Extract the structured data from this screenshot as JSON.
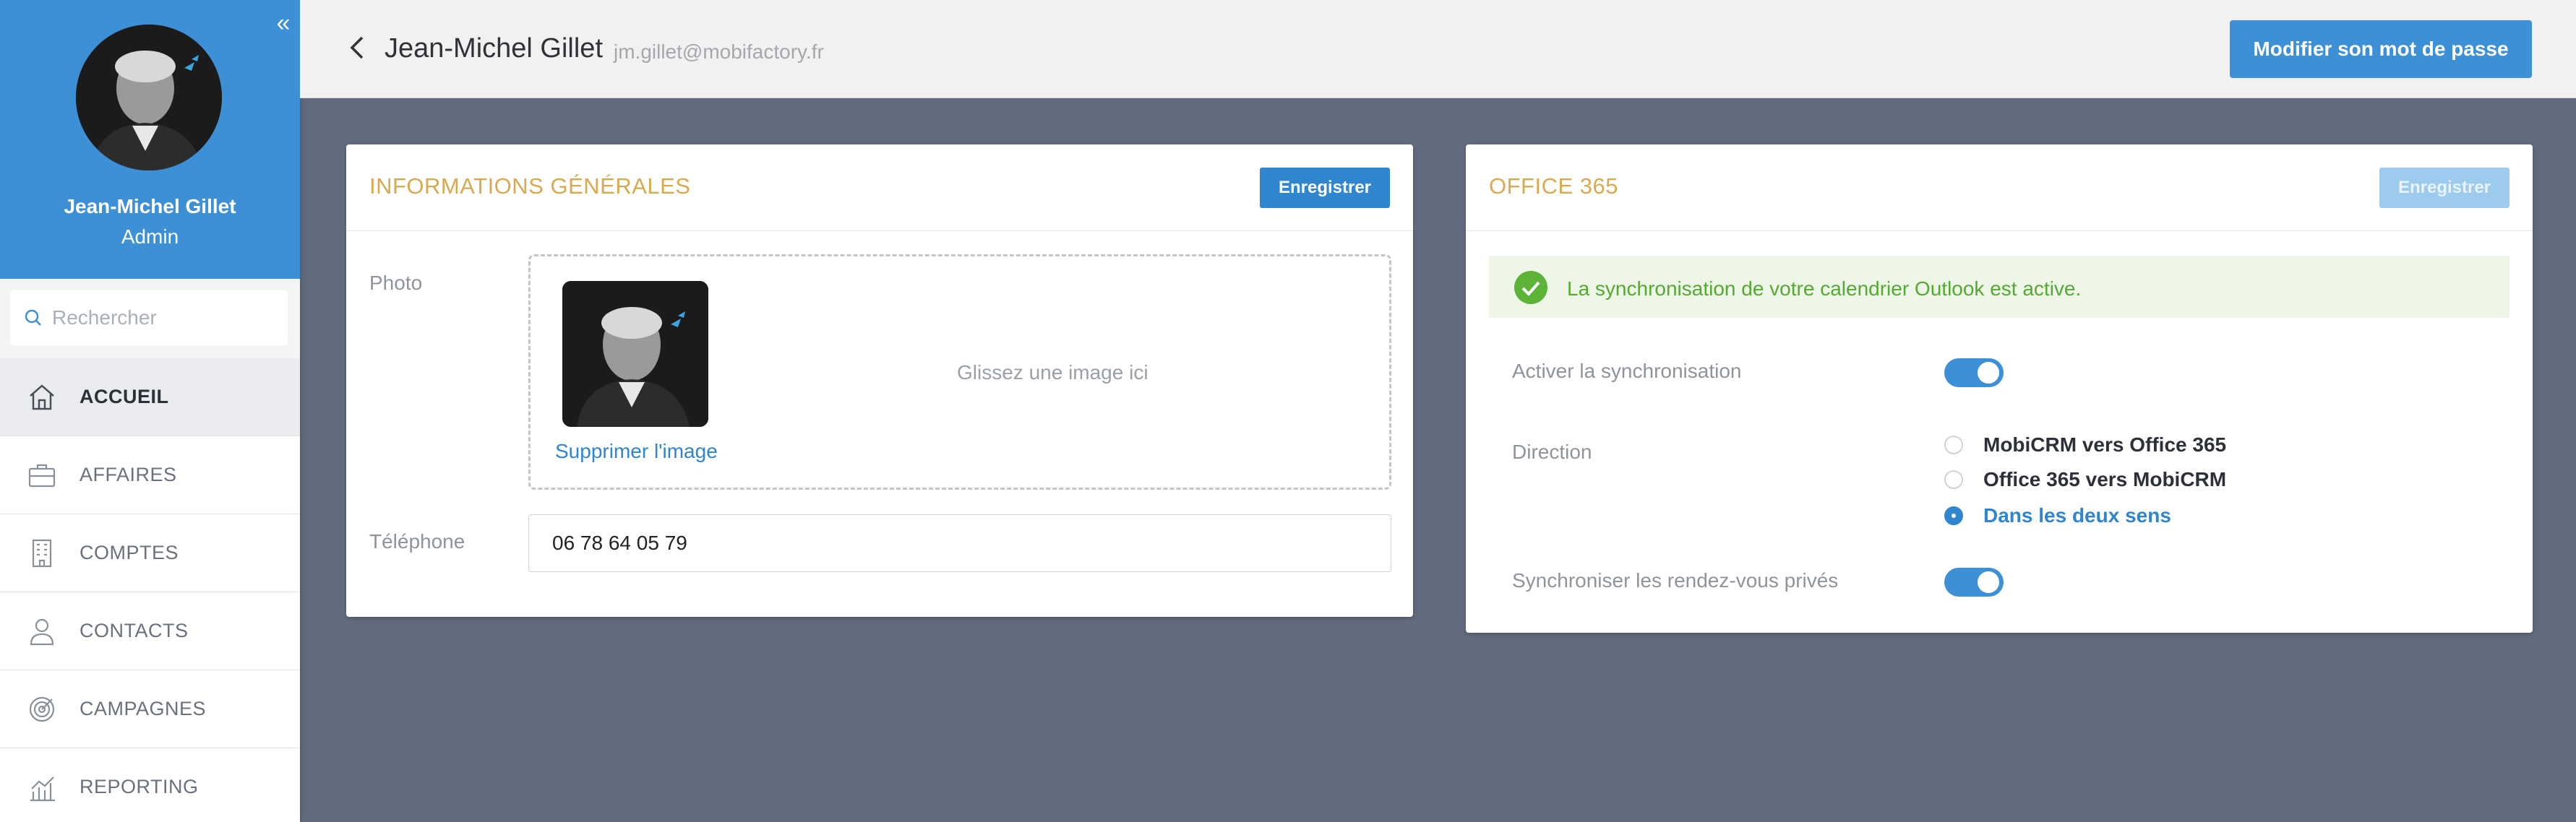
{
  "sidebar": {
    "user_name": "Jean-Michel Gillet",
    "user_role": "Admin",
    "search_placeholder": "Rechercher",
    "items": [
      {
        "label": "ACCUEIL",
        "icon": "home-icon",
        "active": true
      },
      {
        "label": "AFFAIRES",
        "icon": "briefcase-icon",
        "active": false
      },
      {
        "label": "COMPTES",
        "icon": "building-icon",
        "active": false
      },
      {
        "label": "CONTACTS",
        "icon": "person-icon",
        "active": false
      },
      {
        "label": "CAMPAGNES",
        "icon": "target-icon",
        "active": false
      },
      {
        "label": "REPORTING",
        "icon": "chart-icon",
        "active": false
      }
    ]
  },
  "header": {
    "name": "Jean-Michel Gillet",
    "email": "jm.gillet@mobifactory.fr",
    "password_button": "Modifier son mot de passe"
  },
  "general": {
    "title": "INFORMATIONS GÉNÉRALES",
    "save_label": "Enregistrer",
    "photo_label": "Photo",
    "delete_image": "Supprimer l'image",
    "drop_hint": "Glissez une image ici",
    "phone_label": "Téléphone",
    "phone_value": "06 78 64 05 79"
  },
  "office": {
    "title": "OFFICE 365",
    "save_label": "Enregistrer",
    "alert": "La synchronisation de votre calendrier Outlook est active.",
    "sync_label": "Activer la synchronisation",
    "sync_on": true,
    "direction_label": "Direction",
    "directions": [
      {
        "label": "MobiCRM vers Office 365",
        "selected": false
      },
      {
        "label": "Office 365 vers MobiCRM",
        "selected": false
      },
      {
        "label": "Dans les deux sens",
        "selected": true
      }
    ],
    "private_label": "Synchroniser les rendez-vous privés",
    "private_on": true
  },
  "colors": {
    "accent": "#3d8fd6",
    "title_gold": "#d8a951",
    "success": "#55a933",
    "background": "#626a7d"
  }
}
